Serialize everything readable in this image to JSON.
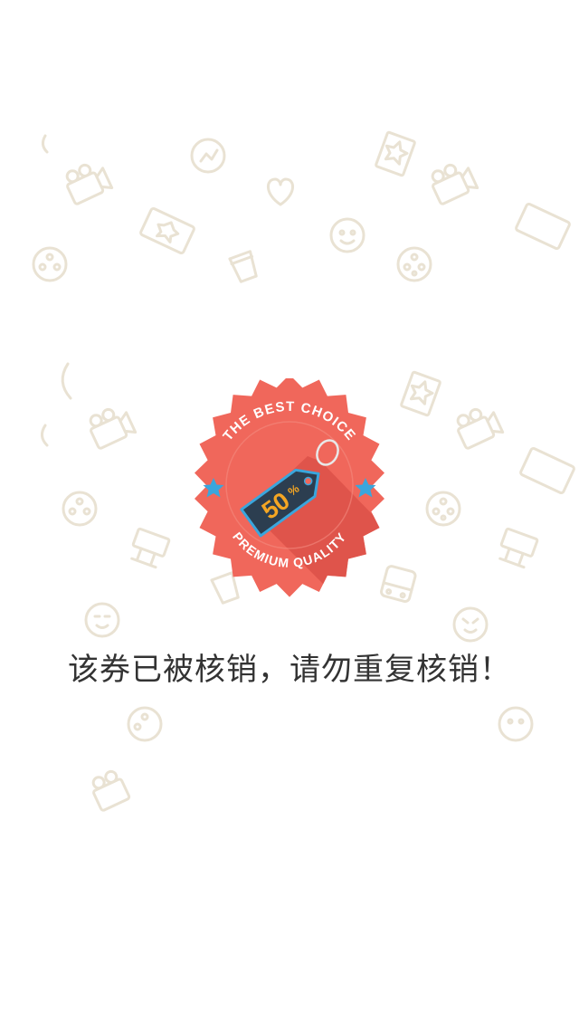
{
  "badge": {
    "top_text": "THE BEST CHOICE",
    "bottom_text": "PREMIUM QUALITY",
    "discount": "50",
    "discount_unit": "%"
  },
  "message": "该券已被核销，请勿重复核销！",
  "colors": {
    "badge_red": "#f0675b",
    "badge_red_dark": "#d94e45",
    "tag_body": "#2c3e50",
    "tag_border": "#3aa6dd",
    "discount_text": "#f5a623",
    "star": "#3aa6dd",
    "pattern": "#e9e2d3"
  },
  "icons": {
    "pattern": [
      "camera-icon",
      "ticket-icon",
      "chart-icon",
      "heart-icon",
      "face-icon",
      "film-reel-icon",
      "cup-icon",
      "bus-icon",
      "billboard-icon"
    ],
    "badge": [
      "star-icon",
      "price-tag-icon"
    ]
  }
}
